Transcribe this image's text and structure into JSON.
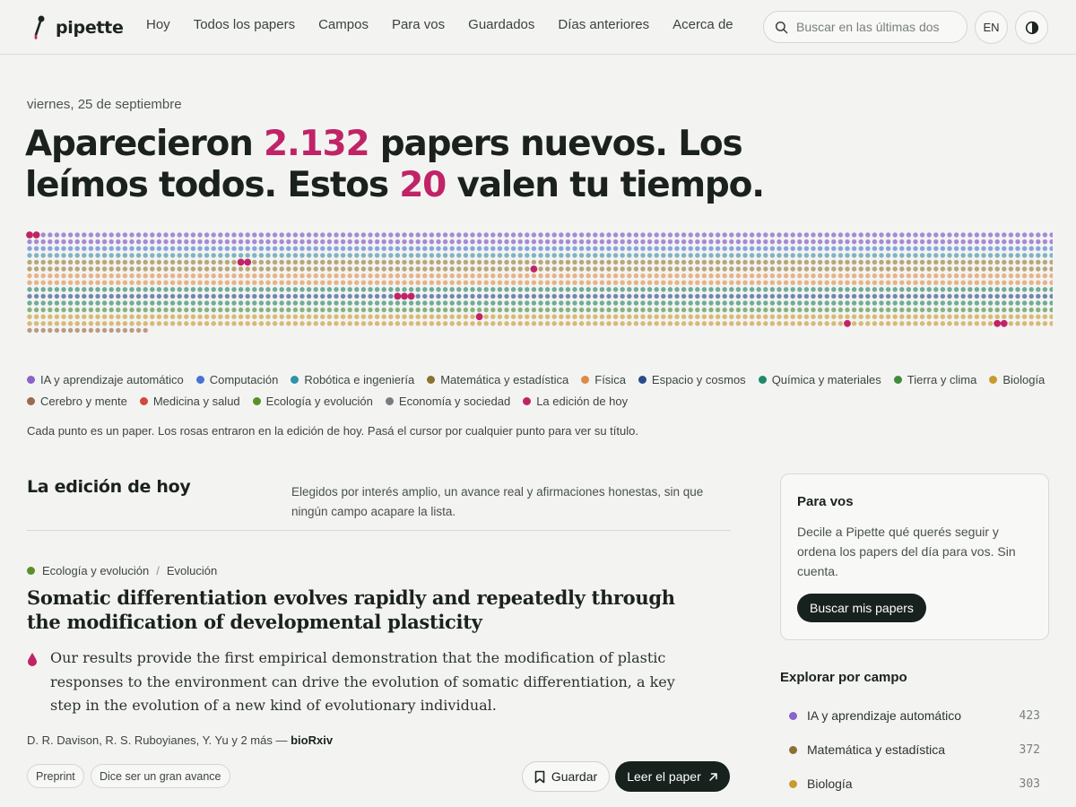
{
  "app": {
    "name": "pipette"
  },
  "nav": [
    {
      "label": "Hoy"
    },
    {
      "label": "Todos los papers"
    },
    {
      "label": "Campos"
    },
    {
      "label": "Para vos"
    },
    {
      "label": "Guardados"
    },
    {
      "label": "Días anteriores"
    },
    {
      "label": "Acerca de"
    }
  ],
  "search": {
    "placeholder": "Buscar en las últimas dos"
  },
  "lang_button": "EN",
  "hero": {
    "date": "viernes, 25 de septiembre",
    "line1_a": "Aparecieron ",
    "line1_num": "2.132",
    "line1_b": " papers nuevos. Los",
    "line2_a": "leímos todos. Estos ",
    "line2_num": "20",
    "line2_b": " valen tu tiempo."
  },
  "colors": {
    "accent": "#c02466",
    "dark_button": "#17211d",
    "today_dot": "#c02466"
  },
  "dot_grid": {
    "total_papers": 2132,
    "selected_today": 20
  },
  "legend": [
    {
      "label": "IA y aprendizaje automático",
      "color": "#8b63c9",
      "dotColor": "#a58bd6"
    },
    {
      "label": "Computación",
      "color": "#4a72d6",
      "dotColor": "#8aa3df"
    },
    {
      "label": "Robótica e ingeniería",
      "color": "#2f92a8",
      "dotColor": "#7fb4c3"
    },
    {
      "label": "Matemática y estadística",
      "color": "#8a7232",
      "dotColor": "#b9a67a"
    },
    {
      "label": "Física",
      "color": "#e08a45",
      "dotColor": "#e7b287"
    },
    {
      "label": "Espacio y cosmos",
      "color": "#2b4a8c",
      "dotColor": "#7287b1"
    },
    {
      "label": "Química y materiales",
      "color": "#1f8a6a",
      "dotColor": "#6fad98"
    },
    {
      "label": "Tierra y clima",
      "color": "#3f8c3a",
      "dotColor": "#86b37f"
    },
    {
      "label": "Biología",
      "color": "#c99a2e",
      "dotColor": "#d7b978"
    },
    {
      "label": "Cerebro y mente",
      "color": "#9c6a4f",
      "dotColor": "#bc9a86"
    },
    {
      "label": "Medicina y salud",
      "color": "#d0493b",
      "dotColor": "#dc8e83"
    },
    {
      "label": "Ecología y evolución",
      "color": "#5b8f2a",
      "dotColor": "#9ab679"
    },
    {
      "label": "Economía y sociedad",
      "color": "#777c82",
      "dotColor": "#a6aaae"
    },
    {
      "label": "La edición de hoy",
      "color": "#c02466",
      "dotColor": "#c02466"
    }
  ],
  "hint": "Cada punto es un paper. Los rosas entraron en la edición de hoy. Pasá el cursor por cualquier punto para ver su título.",
  "edition": {
    "title": "La edición de hoy",
    "description": "Elegidos por interés amplio, un avance real y afirmaciones honestas, sin que ningún campo acapare la lista."
  },
  "paper": {
    "field": "Ecología y evolución",
    "subfield": "Evolución",
    "title": "Somatic differentiation evolves rapidly and repeatedly through the modification of developmental plasticity",
    "abstract": "Our results provide the first empirical demonstration that the modification of plastic responses to the environment can drive the evolution of somatic differentiation, a key step in the evolution of a new kind of evolutionary individual.",
    "authors": "D. R. Davison, R. S. Ruboyianes, Y. Yu y 2 más — ",
    "source": "bioRxiv",
    "tags": [
      "Preprint",
      "Dice ser un gran avance"
    ],
    "save_label": "Guardar",
    "read_label": "Leer el paper"
  },
  "for_you": {
    "title": "Para vos",
    "text": "Decile a Pipette qué querés seguir y ordena los papers del día para vos. Sin cuenta.",
    "button": "Buscar mis papers"
  },
  "explore": {
    "title": "Explorar por campo",
    "fields": [
      {
        "label": "IA y aprendizaje automático",
        "count": "423",
        "color": "#8b63c9"
      },
      {
        "label": "Matemática y estadística",
        "count": "372",
        "color": "#8a7232"
      },
      {
        "label": "Biología",
        "count": "303",
        "color": "#c99a2e"
      }
    ]
  }
}
